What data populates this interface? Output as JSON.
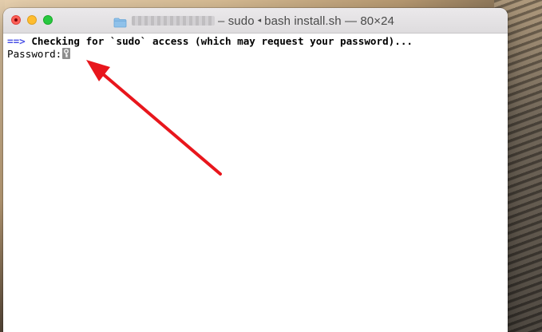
{
  "window": {
    "title_suffix": "– sudo",
    "title_process": "bash install.sh — 80×24",
    "traffic_lights": {
      "close": "#fe5f57",
      "minimize": "#febc2e",
      "zoom": "#28c840"
    }
  },
  "terminal": {
    "line1": {
      "arrow": "==>",
      "text": " Checking for `sudo` access (which may request your password)..."
    },
    "line2": {
      "prompt": "Password:"
    },
    "accent_color": "#4a52e6"
  },
  "annotation": {
    "color": "#e8161c"
  },
  "icons": {
    "folder": "folder-icon",
    "cursor": "key-cursor-icon",
    "arrow": "red-arrow-annotation"
  }
}
